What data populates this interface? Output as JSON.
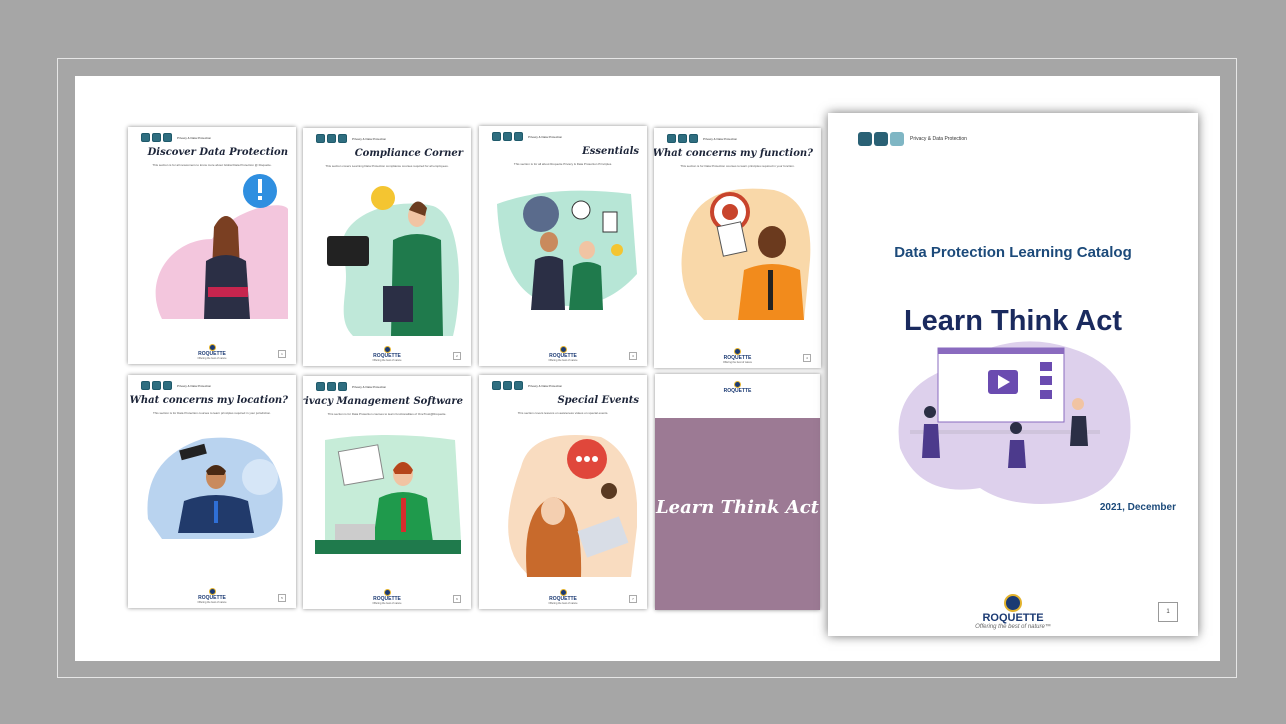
{
  "branding": {
    "pdp_label": "Privacy & Data Protection",
    "company": "ROQUETTE",
    "tagline": "Offering the best of nature",
    "tagline_cover": "Offering the best of nature™"
  },
  "pages": [
    {
      "title": "Discover Data Protection",
      "description": "This section is for all newcomers to know more about Global Data Protection @ Roquette.",
      "page_number": "1",
      "art_color": "#f3c6dd"
    },
    {
      "title": "Compliance Corner",
      "description": "This section covers Learning Data Protection compliance courses required for all employees.",
      "page_number": "2",
      "art_color": "#bfe8d9"
    },
    {
      "title": "Essentials",
      "description": "This section is for all about Roquette Privacy & Data Protection Principles.",
      "page_number": "3",
      "art_color": "#b7e6d6"
    },
    {
      "title": "What concerns my function?",
      "description": "This section is for Data Protection courses to learn principles required in your function.",
      "page_number": "4",
      "art_color": "#f9d8a9"
    },
    {
      "title": "What concerns my location?",
      "description": "This section is for Data Protection courses to learn principles required in your jurisdiction.",
      "page_number": "5",
      "art_color": "#b9d3ef"
    },
    {
      "title": "Our Privacy Management Software",
      "description": "This section is for Data Protection courses to learn functionalities of OneTrust@Roquette.",
      "page_number": "6",
      "art_color": "#c6ecd8"
    },
    {
      "title": "Special Events",
      "description": "This section covers lessons on awareness videos on special events.",
      "page_number": "7",
      "art_color": "#f9dcc0"
    }
  ],
  "purple_page": {
    "title": "Learn Think Act"
  },
  "cover": {
    "catalog_title": "Data Protection Learning Catalog",
    "headline": "Learn Think Act",
    "date": "2021, December",
    "page_number": "1"
  }
}
